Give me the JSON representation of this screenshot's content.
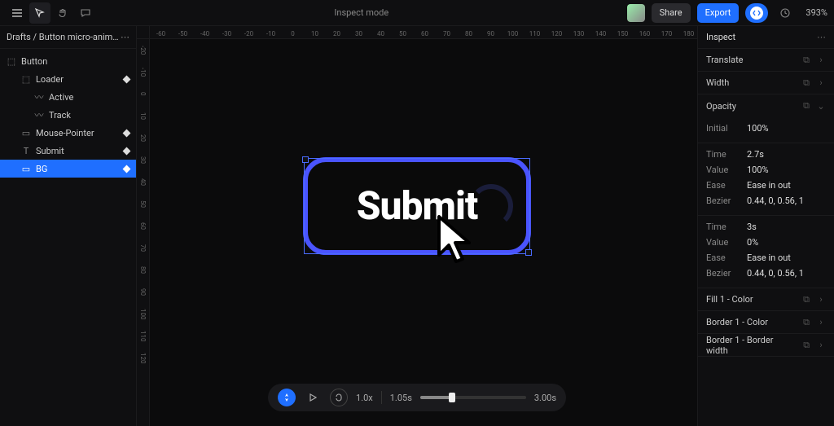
{
  "topbar": {
    "title": "Inspect mode",
    "share": "Share",
    "export": "Export",
    "zoom": "393%"
  },
  "breadcrumb": "Drafts / Button micro-animation...",
  "layers": [
    {
      "name": "Button",
      "indent": 0,
      "kind": "frame",
      "key": false,
      "selected": false
    },
    {
      "name": "Loader",
      "indent": 1,
      "kind": "group",
      "key": true,
      "selected": false
    },
    {
      "name": "Active",
      "indent": 2,
      "kind": "path",
      "key": false,
      "selected": false
    },
    {
      "name": "Track",
      "indent": 2,
      "kind": "path",
      "key": false,
      "selected": false
    },
    {
      "name": "Mouse-Pointer",
      "indent": 1,
      "kind": "rect",
      "key": true,
      "selected": false
    },
    {
      "name": "Submit",
      "indent": 1,
      "kind": "text",
      "key": true,
      "selected": false
    },
    {
      "name": "BG",
      "indent": 1,
      "kind": "rect",
      "key": true,
      "selected": true
    }
  ],
  "canvas": {
    "button_label": "Submit",
    "ruler_h": [
      "-60",
      "-50",
      "-40",
      "-30",
      "-20",
      "-10",
      "0",
      "10",
      "20",
      "30",
      "40",
      "50",
      "60",
      "70",
      "80",
      "90",
      "100",
      "110",
      "120",
      "130",
      "140",
      "150",
      "160",
      "170",
      "180"
    ],
    "ruler_v": [
      "-20",
      "-10",
      "0",
      "10",
      "20",
      "30",
      "40",
      "50",
      "60",
      "70",
      "80",
      "90",
      "100",
      "110",
      "120"
    ]
  },
  "timeline": {
    "speed": "1.0x",
    "current": "1.05s",
    "end": "3.00s"
  },
  "inspector": {
    "title": "Inspect",
    "sections": {
      "translate": "Translate",
      "width": "Width",
      "opacity": "Opacity",
      "fill": "Fill 1 - Color",
      "border_color": "Border 1 - Color",
      "border_width": "Border 1 - Border width"
    },
    "opacity": {
      "initial_label": "Initial",
      "initial_value": "100%",
      "key1": {
        "time_label": "Time",
        "time": "2.7s",
        "value_label": "Value",
        "value": "100%",
        "ease_label": "Ease",
        "ease": "Ease in out",
        "bezier_label": "Bezier",
        "bezier": "0.44, 0, 0.56, 1"
      },
      "key2": {
        "time_label": "Time",
        "time": "3s",
        "value_label": "Value",
        "value": "0%",
        "ease_label": "Ease",
        "ease": "Ease in out",
        "bezier_label": "Bezier",
        "bezier": "0.44, 0, 0.56, 1"
      }
    }
  }
}
